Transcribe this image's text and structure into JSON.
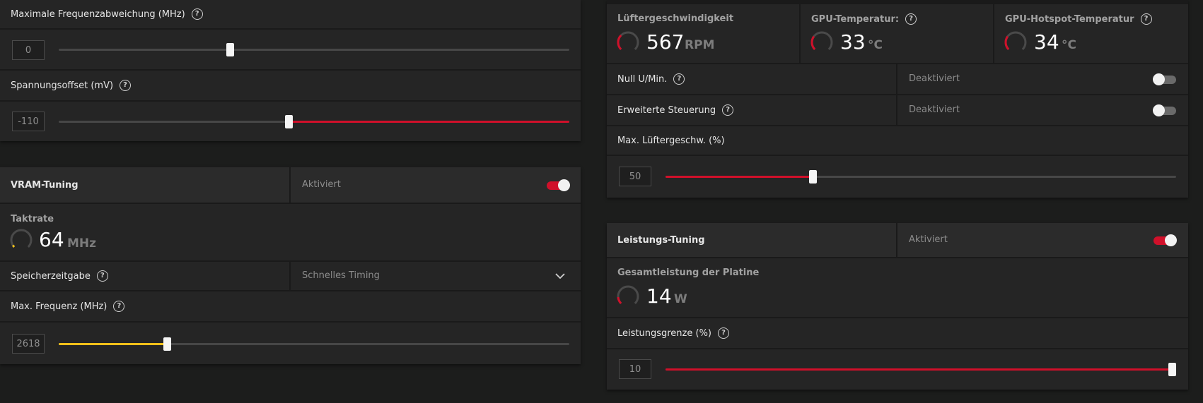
{
  "colors": {
    "accent_red": "#d0102a",
    "accent_yellow": "#f2c01a",
    "track": "#474747"
  },
  "left_top": {
    "freq_dev": {
      "label": "Maximale Frequenzabweichung (MHz)",
      "value": "0"
    },
    "voltage": {
      "label": "Spannungsoffset (mV)",
      "value": "-110"
    }
  },
  "vram": {
    "title": "VRAM-Tuning",
    "status": "Aktiviert",
    "clock": {
      "title": "Taktrate",
      "value": "64",
      "unit": "MHz"
    },
    "timing": {
      "label": "Speicherzeitgabe",
      "selected": "Schnelles Timing"
    },
    "max_freq": {
      "label": "Max. Frequenz (MHz)",
      "value": "2618"
    }
  },
  "fan": {
    "speed": {
      "title": "Lüftergeschwindigkeit",
      "value": "567",
      "unit": "RPM"
    },
    "gpu_temp": {
      "title": "GPU-Temperatur:",
      "value": "33",
      "unit": "°C"
    },
    "hotspot_temp": {
      "title": "GPU-Hotspot-Temperatur",
      "value": "34",
      "unit": "°C"
    },
    "zero_rpm": {
      "label": "Null U/Min.",
      "status": "Deaktiviert"
    },
    "advanced": {
      "label": "Erweiterte Steuerung",
      "status": "Deaktiviert"
    },
    "max_speed": {
      "label": "Max. Lüftergeschw. (%)",
      "value": "50"
    }
  },
  "power": {
    "title": "Leistungs-Tuning",
    "status": "Aktiviert",
    "board_power": {
      "title": "Gesamtleistung der Platine",
      "value": "14",
      "unit": "W"
    },
    "limit": {
      "label": "Leistungsgrenze (%)",
      "value": "10"
    }
  },
  "icons": {
    "help": "?",
    "chevron": "chevron-down-icon"
  }
}
